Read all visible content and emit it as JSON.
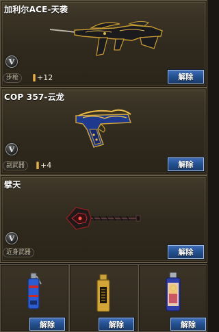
{
  "slots": [
    {
      "title": "加利尔ACE-天袭",
      "badge": "V",
      "category": "步枪",
      "bonus": "+12",
      "button": "解除",
      "weapon_icon": "assault-rifle-icon"
    },
    {
      "title": "COP 357-云龙",
      "badge": "V",
      "category": "副武器",
      "bonus": "+4",
      "button": "解除",
      "weapon_icon": "pistol-icon"
    },
    {
      "title": "擘天",
      "badge": "V",
      "category": "近身武器",
      "button": "解除",
      "weapon_icon": "shovel-icon"
    }
  ],
  "throwables": [
    {
      "button": "解除",
      "icon": "grenade-icon"
    },
    {
      "button": "解除",
      "icon": "smoke-grenade-icon"
    },
    {
      "button": "解除",
      "icon": "flashbang-icon"
    }
  ],
  "colors": {
    "button_blue": "#24508f",
    "panel_brown": "#2e281d",
    "gold": "#d6a73c"
  }
}
